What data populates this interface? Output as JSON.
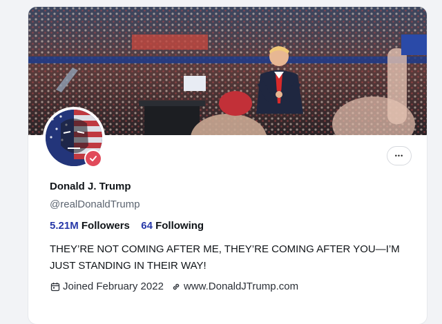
{
  "profile": {
    "display_name": "Donald J. Trump",
    "handle": "@realDonaldTrump",
    "followers_count": "5.21M",
    "followers_label": "Followers",
    "following_count": "64",
    "following_label": "Following",
    "bio": "THEY’RE NOT COMING AFTER ME, THEY’RE COMING AFTER YOU—I’M JUST STANDING IN THEIR WAY!",
    "joined": "Joined February 2022",
    "website": "www.DonaldJTrump.com"
  },
  "icons": {
    "more": "more-horizontal-icon",
    "verified": "verified-badge-icon",
    "calendar": "calendar-icon",
    "link": "link-icon"
  },
  "colors": {
    "accent_link": "#2738a8",
    "verified_badge": "#e14a5a"
  },
  "more_button_label": "•••"
}
